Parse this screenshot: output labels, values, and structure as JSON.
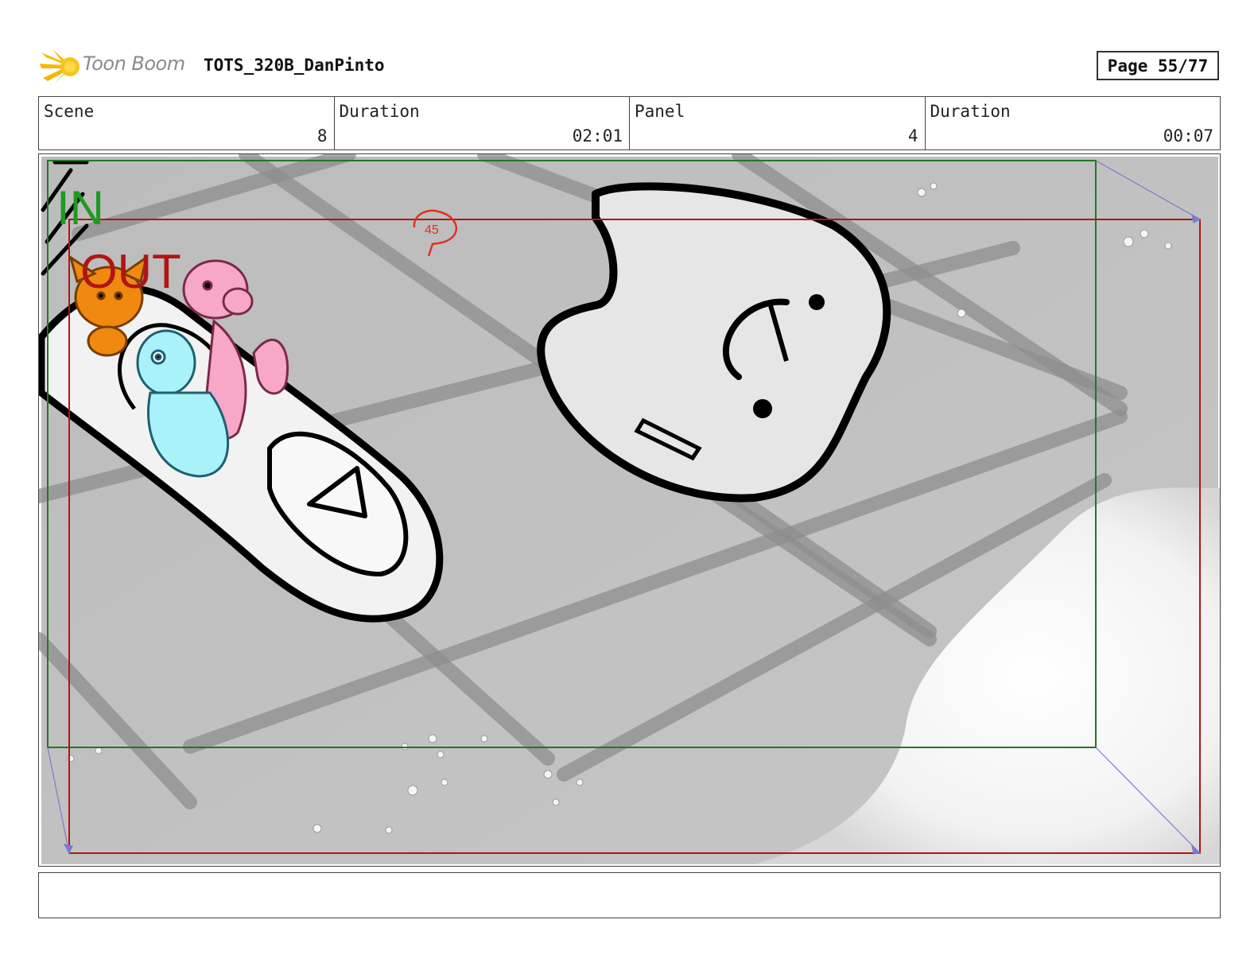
{
  "header": {
    "brand": "Toon Boom",
    "project_name": "TOTS_320B_DanPinto",
    "page_label": "Page 55/77"
  },
  "info": {
    "scene_label": "Scene",
    "scene_value": "8",
    "scene_duration_label": "Duration",
    "scene_duration_value": "02:01",
    "panel_label": "Panel",
    "panel_value": "4",
    "panel_duration_label": "Duration",
    "panel_duration_value": "00:07"
  },
  "panel_image": {
    "in_marker": "IN",
    "out_marker": "OUT",
    "doodle_text": "45",
    "colors": {
      "in_frame": "#1e7a1e",
      "out_frame": "#b01515",
      "doodle": "#e0301e",
      "orange_character": "#f0890f",
      "pink_character": "#f7a8c8",
      "cyan_character": "#a9f2fa"
    }
  },
  "notes": {
    "text": ""
  }
}
